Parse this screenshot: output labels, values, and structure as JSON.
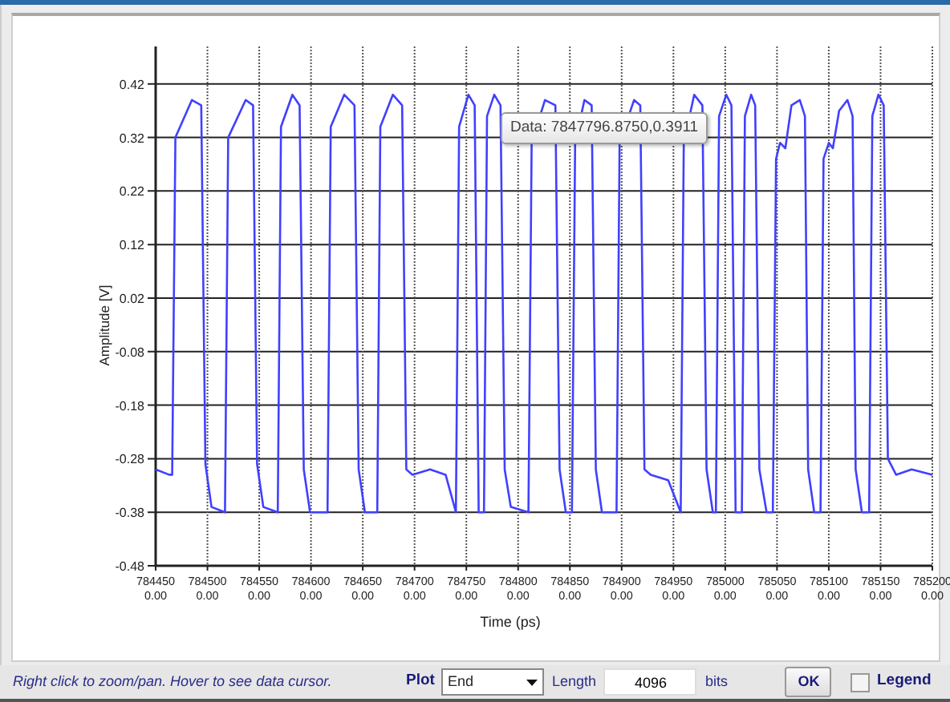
{
  "chart": {
    "chart_data": {
      "type": "line",
      "xlabel": "Time (ps)",
      "ylabel": "Amplitude [V]",
      "xlim": [
        784450,
        785200
      ],
      "ylim": [
        -0.48,
        0.49
      ],
      "grid": true,
      "xticks": [
        784450,
        784500,
        784550,
        784600,
        784650,
        784700,
        784750,
        784800,
        784850,
        784900,
        784950,
        785000,
        785050,
        785100,
        785150,
        785200
      ],
      "yticks": [
        {
          "value": 0.42,
          "label": "0.42"
        },
        {
          "value": 0.32,
          "label": "0.32"
        },
        {
          "value": 0.22,
          "label": "0.22"
        },
        {
          "value": 0.12,
          "label": "0.12"
        },
        {
          "value": 0.02,
          "label": "0.02"
        },
        {
          "value": -0.08,
          "label": "-0.08"
        },
        {
          "value": -0.18,
          "label": "-0.18"
        },
        {
          "value": -0.28,
          "label": "-0.28"
        },
        {
          "value": -0.38,
          "label": "-0.38"
        },
        {
          "value": -0.48,
          "label": "-0.48"
        }
      ],
      "x": [
        784450,
        784463,
        784466,
        784469,
        784485,
        784494,
        784498,
        784504,
        784517,
        784520,
        784537,
        784544,
        784548,
        784554,
        784568,
        784571,
        784582,
        784589,
        784593,
        784599,
        784616,
        784619,
        784632,
        784642,
        784646,
        784652,
        784664,
        784667,
        784679,
        784688,
        784692,
        784698,
        784715,
        784730,
        784740,
        784743,
        784752,
        784758,
        784762,
        784767,
        784770,
        784777,
        784783,
        784787,
        784793,
        784810,
        784813,
        784826,
        784836,
        784840,
        784846,
        784852,
        784855,
        784864,
        784871,
        784875,
        784881,
        784895,
        784898,
        784912,
        784918,
        784922,
        784928,
        784945,
        784957,
        784960,
        784970,
        784978,
        784982,
        784988,
        784991,
        784994,
        785001,
        785006,
        785010,
        785016,
        785019,
        785025,
        785029,
        785033,
        785040,
        785046,
        785049,
        785053,
        785058,
        785064,
        785072,
        785077,
        785080,
        785086,
        785092,
        785095,
        785100,
        785104,
        785110,
        785118,
        785123,
        785126,
        785132,
        785139,
        785142,
        785148,
        785153,
        785157,
        785165,
        785180,
        785200
      ],
      "series": [
        {
          "color": "#4040ff",
          "values": [
            -0.3,
            -0.31,
            -0.31,
            0.32,
            0.39,
            0.38,
            -0.29,
            -0.37,
            -0.38,
            0.32,
            0.39,
            0.38,
            -0.29,
            -0.37,
            -0.38,
            0.34,
            0.4,
            0.38,
            -0.3,
            -0.38,
            -0.38,
            0.34,
            0.4,
            0.38,
            -0.3,
            -0.38,
            -0.38,
            0.34,
            0.4,
            0.38,
            -0.3,
            -0.31,
            -0.3,
            -0.31,
            -0.38,
            0.34,
            0.4,
            0.38,
            -0.38,
            -0.38,
            0.36,
            0.4,
            0.38,
            -0.3,
            -0.37,
            -0.38,
            0.31,
            0.39,
            0.38,
            -0.3,
            -0.38,
            -0.38,
            0.31,
            0.39,
            0.38,
            -0.3,
            -0.38,
            -0.38,
            0.31,
            0.39,
            0.38,
            -0.3,
            -0.31,
            -0.32,
            -0.38,
            0.31,
            0.4,
            0.38,
            -0.3,
            -0.38,
            -0.38,
            0.36,
            0.4,
            0.38,
            -0.38,
            -0.38,
            0.36,
            0.4,
            0.38,
            -0.3,
            -0.38,
            -0.38,
            0.28,
            0.31,
            0.3,
            0.38,
            0.39,
            0.36,
            -0.3,
            -0.38,
            -0.38,
            0.28,
            0.31,
            0.3,
            0.37,
            0.39,
            0.36,
            -0.3,
            -0.38,
            -0.38,
            0.36,
            0.4,
            0.38,
            -0.28,
            -0.31,
            -0.3,
            -0.31
          ]
        }
      ]
    },
    "xtick_sublabels": [
      "0.00",
      "0.00",
      "0.00",
      "0.00",
      "0.00",
      "0.00",
      "0.00",
      "0.00",
      "0.00",
      "0.00",
      "0.00",
      "0.00",
      "0.00",
      "0.00",
      "0.00",
      "0.00"
    ],
    "tooltip": "Data: 7847796.8750,0.3911"
  },
  "footer": {
    "hint": "Right click to zoom/pan. Hover to see data cursor.",
    "plot_label": "Plot",
    "plot_value": "End",
    "length_label": "Length",
    "length_value": "4096",
    "length_unit": "bits",
    "ok_button": "OK",
    "legend": {
      "label": "Legend",
      "checked": false
    }
  }
}
